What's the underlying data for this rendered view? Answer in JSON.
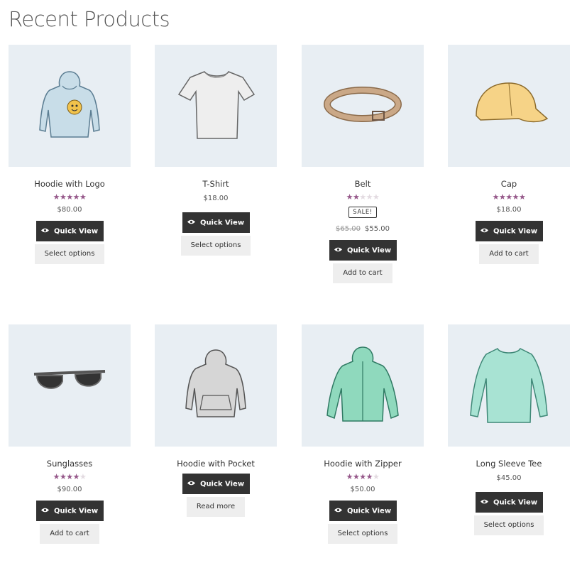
{
  "page": {
    "title": "Recent Products"
  },
  "colors": {
    "star": "#96588a",
    "thumb_bg": "#e8eef3",
    "button_dark": "#333333",
    "button_light": "#eeeeee"
  },
  "products": [
    {
      "name": "Hoodie with Logo",
      "rating": 5,
      "price": "$80.00",
      "action": "Select options",
      "quick_view": "Quick View",
      "icon": "hoodie-logo"
    },
    {
      "name": "T-Shirt",
      "price": "$18.00",
      "action": "Select options",
      "quick_view": "Quick View",
      "icon": "t-shirt"
    },
    {
      "name": "Belt",
      "rating": 2,
      "sale_badge": "SALE!",
      "old_price": "$65.00",
      "price": "$55.00",
      "action": "Add to cart",
      "quick_view": "Quick View",
      "icon": "belt"
    },
    {
      "name": "Cap",
      "rating": 5,
      "price": "$18.00",
      "action": "Add to cart",
      "quick_view": "Quick View",
      "icon": "cap"
    },
    {
      "name": "Sunglasses",
      "rating": 4,
      "price": "$90.00",
      "action": "Add to cart",
      "quick_view": "Quick View",
      "icon": "sunglasses"
    },
    {
      "name": "Hoodie with Pocket",
      "action": "Read more",
      "quick_view": "Quick View",
      "icon": "hoodie-pocket"
    },
    {
      "name": "Hoodie with Zipper",
      "rating": 4,
      "price": "$50.00",
      "action": "Select options",
      "quick_view": "Quick View",
      "icon": "hoodie-zipper"
    },
    {
      "name": "Long Sleeve Tee",
      "price": "$45.00",
      "action": "Select options",
      "quick_view": "Quick View",
      "icon": "long-sleeve-tee"
    }
  ]
}
